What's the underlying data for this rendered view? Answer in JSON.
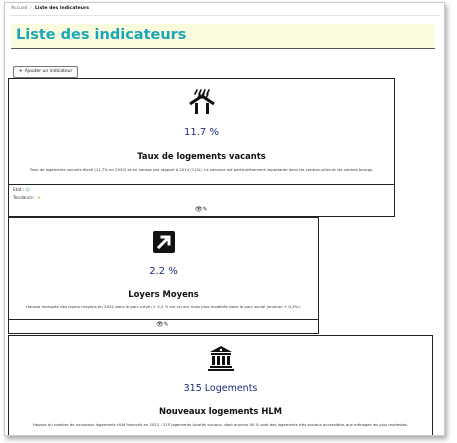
{
  "breadcrumb": {
    "home": "Accueil",
    "separator": "/",
    "current": "Liste des indicateurs"
  },
  "page_title": "Liste des indicateurs",
  "add_button": {
    "icon": "+",
    "label": "Ajouter un indicateur"
  },
  "cards": [
    {
      "icon": "house-rain-icon",
      "value": "11.7 %",
      "title": "Taux de logements vacants",
      "description": "Taux de logements vacants élevé (11,7% en 2020) et en hausse par rapport à 2014 (11%). La vacance est particulièrement importante dans les centres-villes et les centres bourgs.",
      "etat_label": "Etat :",
      "etat_icon": "☺",
      "tendance_label": "Tendance :",
      "tendance_icon": "➜",
      "view_icon": "👁",
      "edit_icon": "✎"
    },
    {
      "icon": "arrow-up-right-icon",
      "value": "2.2 %",
      "title": "Loyers Moyens",
      "description": "Hausse marquée des loyers moyens en 2022 dans le parc privé (+ 2,2 % sur un an) mais plus modérée dans le parc social (environ + 0,3%).",
      "view_icon": "👁",
      "edit_icon": "✎"
    },
    {
      "icon": "landmark-icon",
      "value": "315 Logements",
      "title": "Nouveaux logements HLM",
      "description": "Hausse du nombre de nouveaux logements HLM financés en 2022 : 315 logements locatifs sociaux, dont environ 40 % sont des logements très sociaux accessibles aux ménages les plus modestes."
    }
  ]
}
